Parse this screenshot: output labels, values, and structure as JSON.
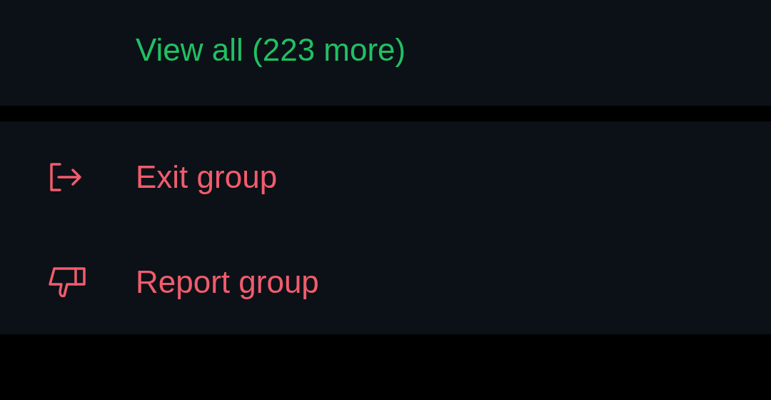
{
  "view_all": {
    "label": "View all (223 more)"
  },
  "actions": [
    {
      "kind": "exit",
      "label": "Exit group"
    },
    {
      "kind": "report",
      "label": "Report group"
    }
  ]
}
